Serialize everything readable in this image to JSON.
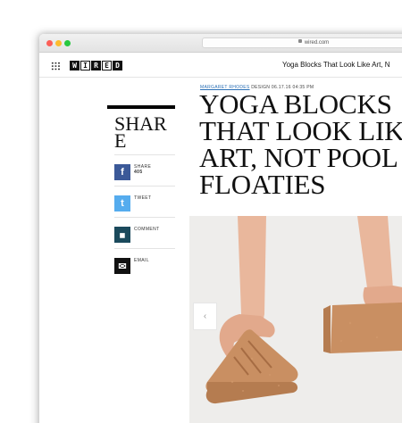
{
  "browser": {
    "address": "wired.com"
  },
  "site": {
    "logo_letters": [
      "W",
      "I",
      "R",
      "E",
      "D"
    ],
    "article_title_bar": "Yoga Blocks That Look Like Art, N"
  },
  "share": {
    "title": "SHARE",
    "items": [
      {
        "label": "SHARE",
        "count": "405",
        "icon": "facebook-icon",
        "color": "#3b5998",
        "glyph": "f"
      },
      {
        "label": "TWEET",
        "icon": "twitter-icon",
        "color": "#55acee",
        "glyph": "t"
      },
      {
        "label": "COMMENT",
        "icon": "comment-icon",
        "color": "#1b4a5c",
        "glyph": "◼"
      },
      {
        "label": "EMAIL",
        "icon": "email-icon",
        "color": "#111111",
        "glyph": "✉"
      }
    ]
  },
  "article": {
    "author": "MARGARET RHODES",
    "section": "DESIGN",
    "date": "06.17.16",
    "time": "04:35 PM",
    "headline_lines": [
      "YOGA BLOCKS",
      "THAT LOOK LIKE",
      "ART, NOT POOL",
      "FLOATIES"
    ]
  },
  "gallery": {
    "prev_glyph": "‹"
  },
  "colors": {
    "link": "#2a6fb5"
  }
}
